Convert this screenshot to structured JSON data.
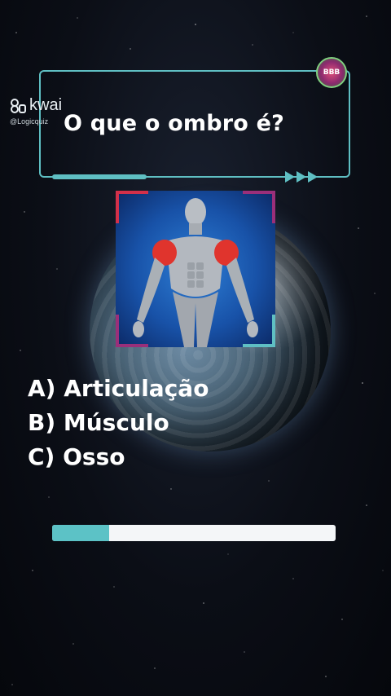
{
  "brand": {
    "logo_text": "kwai",
    "handle": "@Logicquiz",
    "badge_text": "BBB"
  },
  "quiz": {
    "question": "O que o ombro é?",
    "image_icon": "muscular-torso-shoulder-highlighted",
    "options": [
      "A) Articulação",
      "B) Músculo",
      "C) Osso"
    ]
  },
  "timer": {
    "progress_fraction": 0.2
  },
  "colors": {
    "accent": "#5fbfc3",
    "progress_fill": "#5cc2c6",
    "progress_track": "#f4f6f8",
    "image_border_left": "#d2304a",
    "image_border_right": "#9a2f7a"
  }
}
